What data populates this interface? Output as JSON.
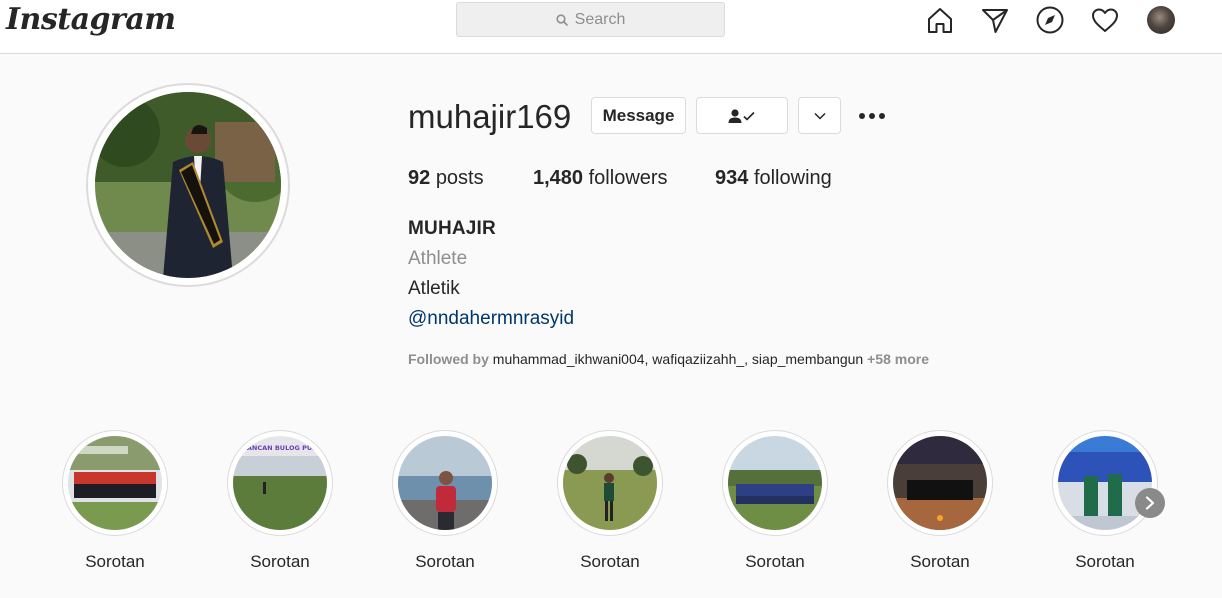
{
  "header": {
    "logo_text": "Instagram",
    "search_placeholder": "Search",
    "icons": [
      "home-icon",
      "direct-icon",
      "explore-icon",
      "activity-icon",
      "profile-avatar"
    ]
  },
  "profile": {
    "username": "muhajir169",
    "message_label": "Message",
    "follow_state_icon": "following-check-icon",
    "dropdown_icon": "chevron-down-icon",
    "options_icon": "more-options-icon",
    "stats": {
      "posts_count": "92",
      "posts_label": "posts",
      "followers_count": "1,480",
      "followers_label": "followers",
      "following_count": "934",
      "following_label": "following"
    },
    "bio": {
      "name": "MUHAJIR",
      "category": "Athlete",
      "text": "Atletik",
      "link": "@nndahermnrasyid"
    },
    "followed_by": {
      "prefix": "Followed by",
      "names": "muhammad_ikhwani004, wafiqaziizahh_, siap_membangun",
      "more": "+58 more"
    }
  },
  "highlights": [
    {
      "label": "Sorotan"
    },
    {
      "label": "Sorotan"
    },
    {
      "label": "Sorotan"
    },
    {
      "label": "Sorotan"
    },
    {
      "label": "Sorotan"
    },
    {
      "label": "Sorotan"
    },
    {
      "label": "Sorotan"
    }
  ],
  "highlight_images_text": {
    "h2_banner": "LAPANCAN BULOG PUNTE"
  },
  "colors": {
    "link": "#00376b",
    "muted": "#8e8e8e",
    "border": "#dbdbdb",
    "text": "#262626"
  }
}
